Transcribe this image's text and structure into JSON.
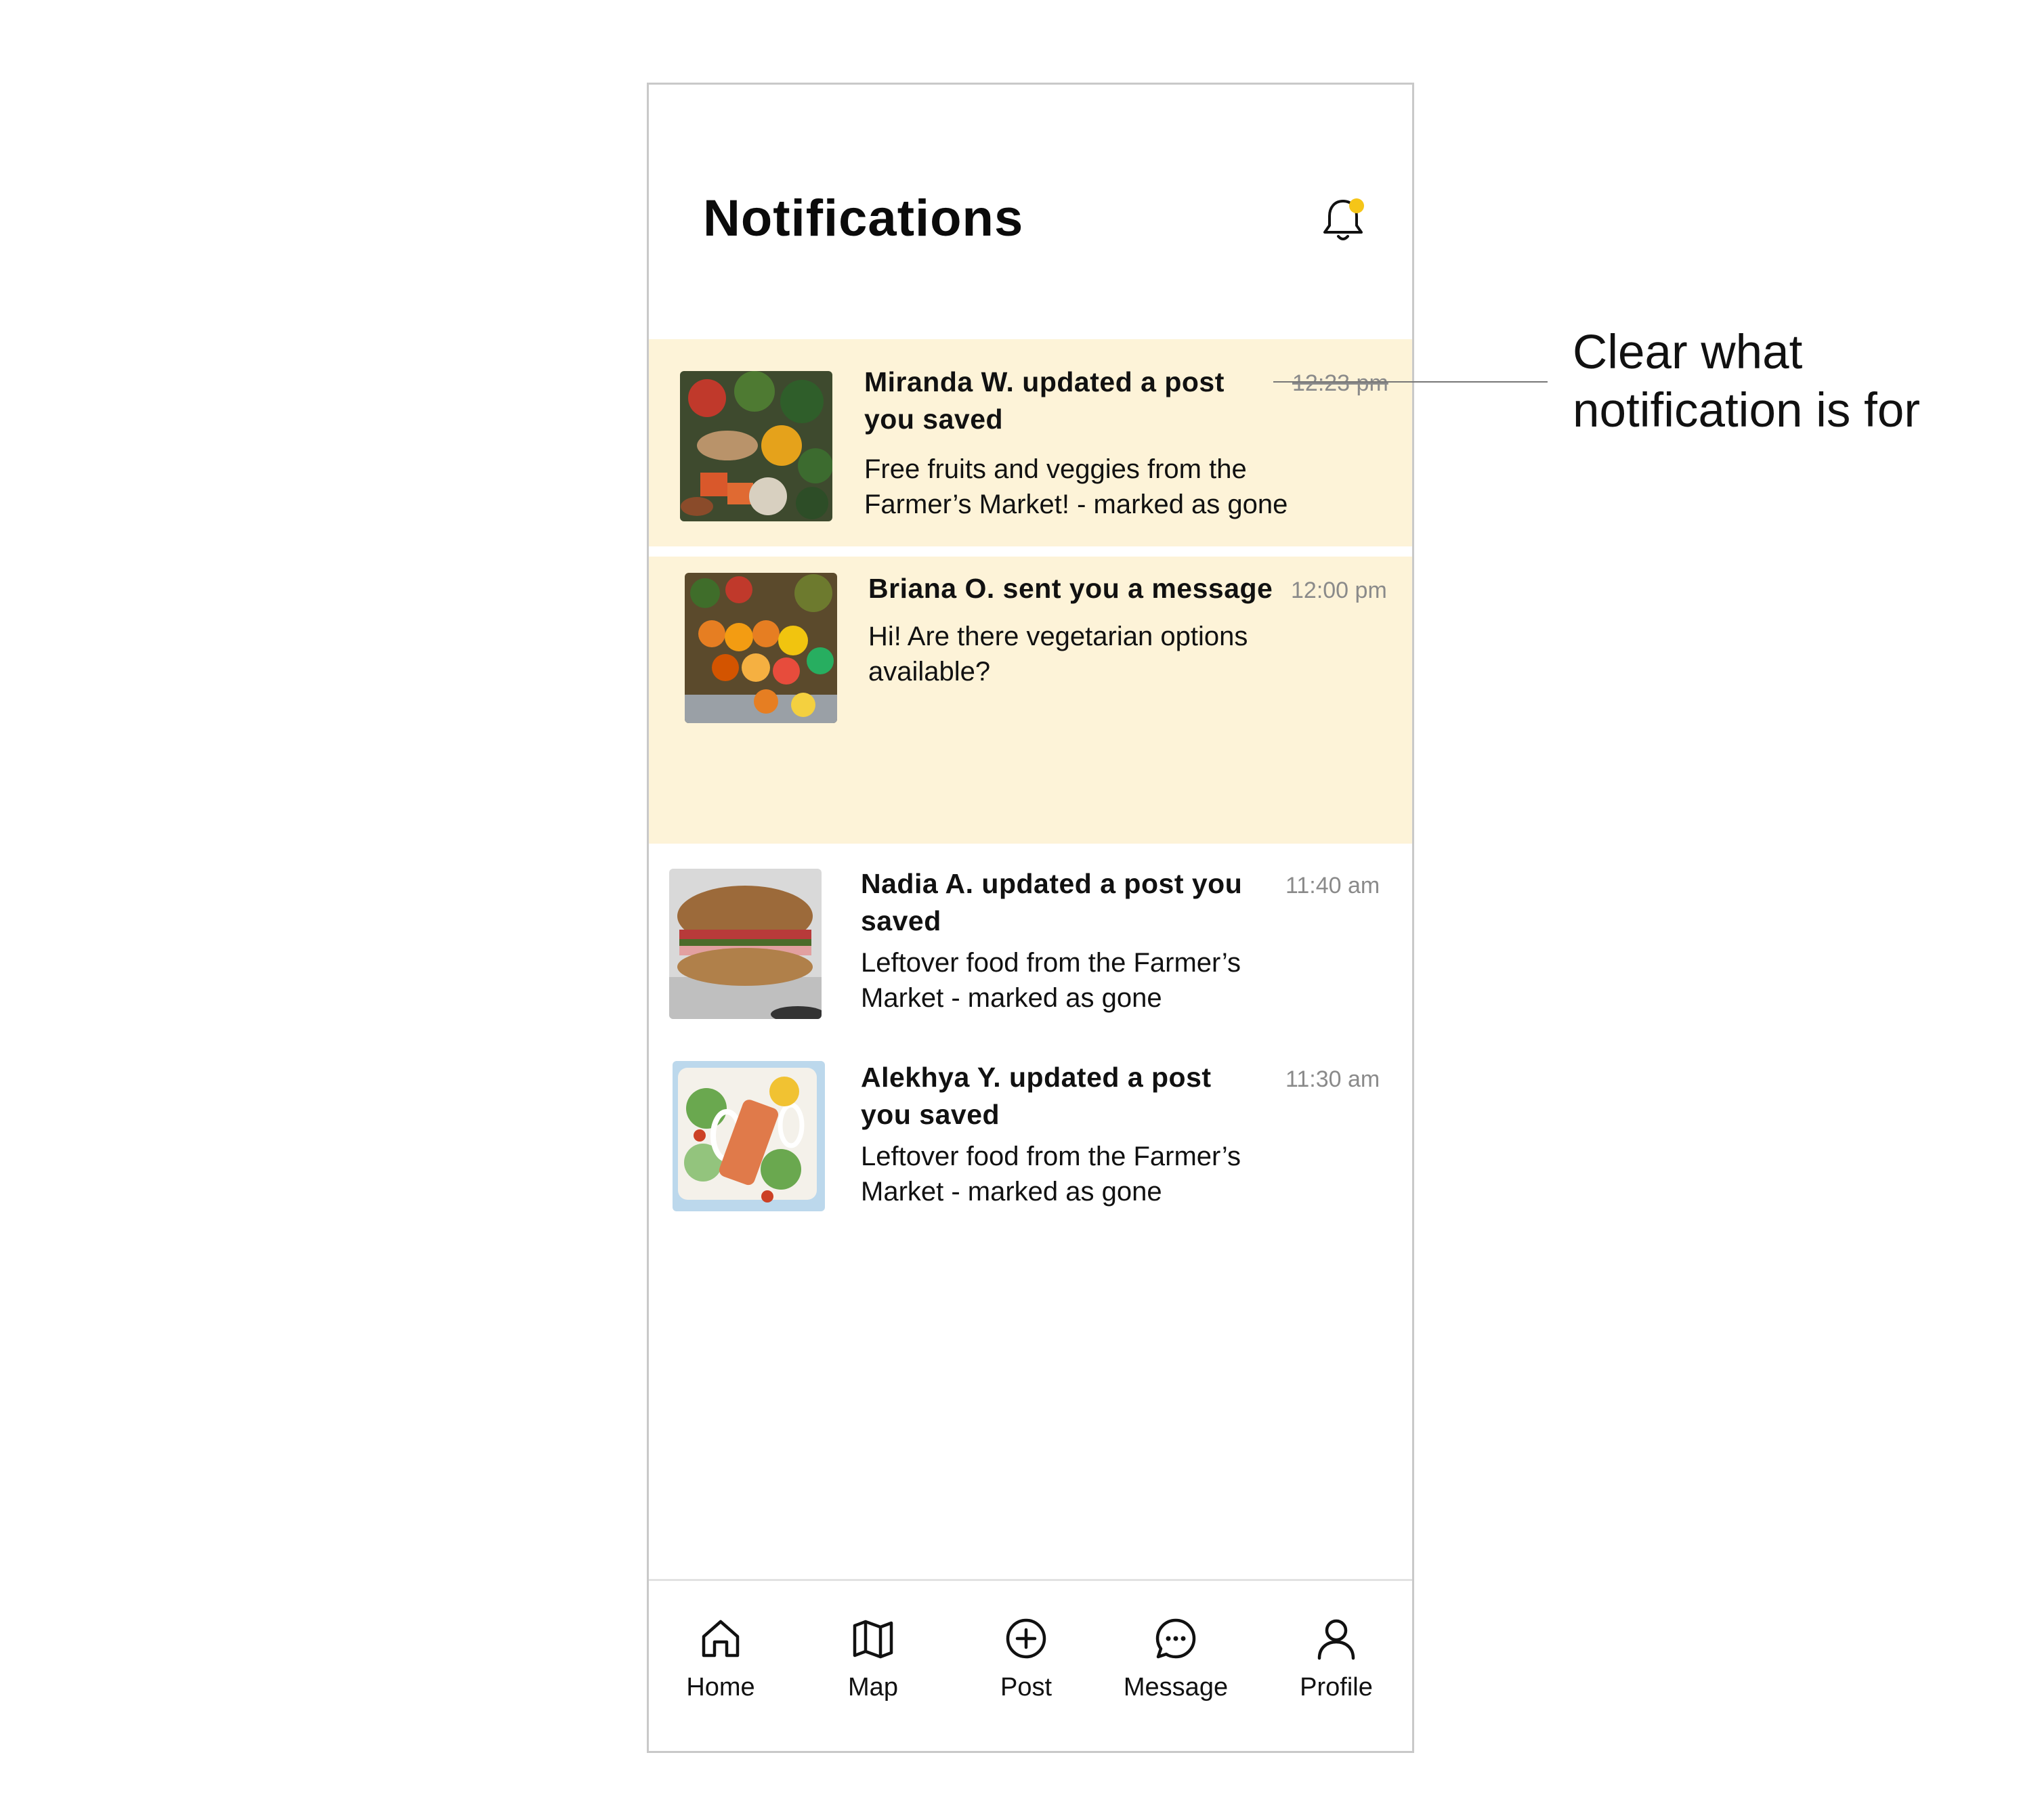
{
  "header": {
    "title": "Notifications",
    "bell_icon": "bell-icon",
    "unread_dot_color": "#f5c518"
  },
  "colors": {
    "highlight_bg": "#fdf3d8",
    "time_text": "#8a8a8a"
  },
  "notifications": [
    {
      "title": "Miranda W. updated a post you saved",
      "body": "Free fruits and veggies from the Farmer’s Market! - marked as gone",
      "time": "12:23 pm",
      "highlighted": true,
      "image": "vegetables-photo"
    },
    {
      "title": "Briana O. sent you a message",
      "body": "Hi! Are there vegetarian options available?",
      "time": "12:00 pm",
      "highlighted": true,
      "image": "fruit-market-photo"
    },
    {
      "title": "Nadia A. updated a post you saved",
      "body": "Leftover food from the Farmer’s Market - marked as gone",
      "time": "11:40 am",
      "highlighted": false,
      "image": "sandwich-photo"
    },
    {
      "title": "Alekhya Y. updated a post you saved",
      "body": "Leftover food from the Farmer’s Market - marked as gone",
      "time": "11:30 am",
      "highlighted": false,
      "image": "salmon-salad-photo"
    }
  ],
  "bottom_nav": {
    "items": [
      {
        "label": "Home",
        "icon": "home-icon"
      },
      {
        "label": "Map",
        "icon": "map-icon"
      },
      {
        "label": "Post",
        "icon": "plus-circle-icon"
      },
      {
        "label": "Message",
        "icon": "message-bubble-icon"
      },
      {
        "label": "Profile",
        "icon": "user-icon"
      }
    ]
  },
  "annotation": {
    "text": "Clear what notification is for"
  }
}
